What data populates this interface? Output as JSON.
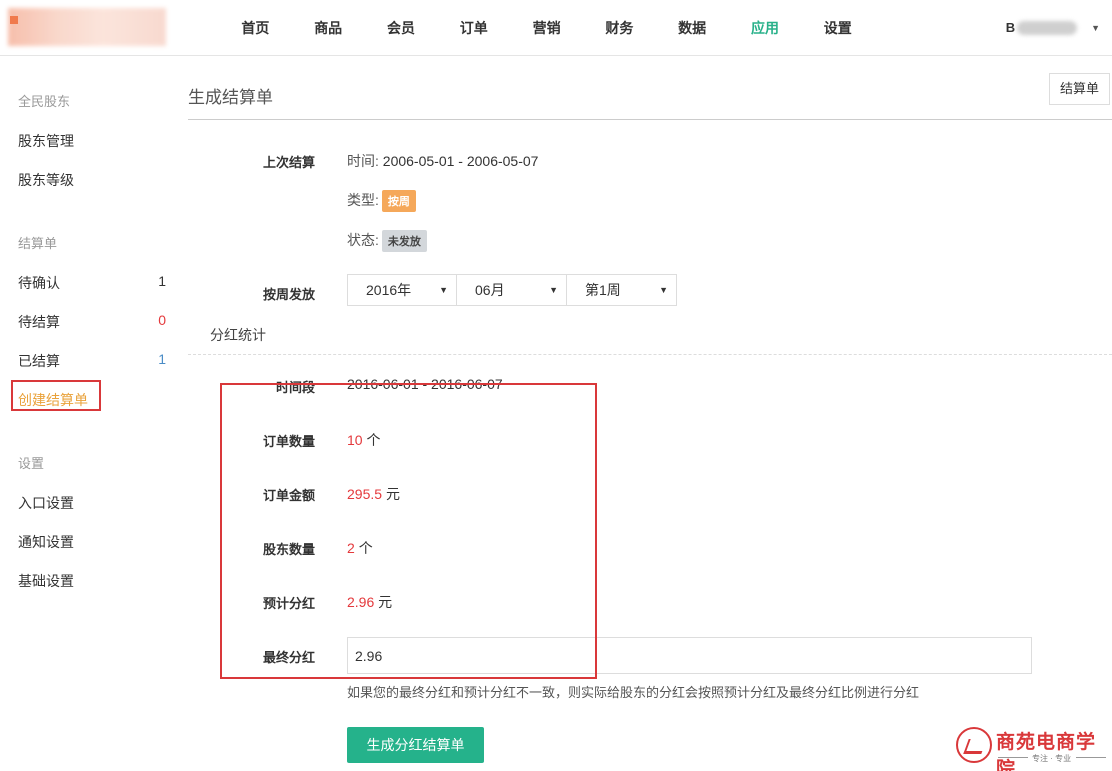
{
  "nav": {
    "items": [
      "首页",
      "商品",
      "会员",
      "订单",
      "营销",
      "财务",
      "数据",
      "应用",
      "设置"
    ],
    "active_index": 7,
    "user_initial": "B"
  },
  "sidebar": {
    "groups": [
      {
        "title": "全民股东",
        "items": [
          {
            "label": "股东管理"
          },
          {
            "label": "股东等级"
          }
        ]
      },
      {
        "title": "结算单",
        "items": [
          {
            "label": "待确认",
            "count": "1"
          },
          {
            "label": "待结算",
            "count": "0"
          },
          {
            "label": "已结算",
            "count": "1"
          },
          {
            "label": "创建结算单",
            "active": true
          }
        ]
      },
      {
        "title": "设置",
        "items": [
          {
            "label": "入口设置"
          },
          {
            "label": "通知设置"
          },
          {
            "label": "基础设置"
          }
        ]
      }
    ]
  },
  "main": {
    "title": "生成结算单",
    "top_button": "结算单",
    "last_settlement": {
      "label": "上次结算",
      "time_label": "时间:",
      "time_value": "2006-05-01 - 2006-05-07",
      "type_label": "类型:",
      "type_badge": "按周",
      "status_label": "状态:",
      "status_badge": "未发放"
    },
    "weekly_issue": {
      "label": "按周发放",
      "year": "2016年",
      "month": "06月",
      "week": "第1周"
    },
    "stats_title": "分红统计",
    "period": {
      "label": "时间段",
      "value": "2016-06-01 - 2016-06-07"
    },
    "order_count": {
      "label": "订单数量",
      "value": "10",
      "unit": "个"
    },
    "order_amount": {
      "label": "订单金额",
      "value": "295.5",
      "unit": "元"
    },
    "shareholder_count": {
      "label": "股东数量",
      "value": "2",
      "unit": "个"
    },
    "estimated_dividend": {
      "label": "预计分红",
      "value": "2.96",
      "unit": "元"
    },
    "final_dividend": {
      "label": "最终分红",
      "value": "2.96"
    },
    "hint": "如果您的最终分红和预计分红不一致，则实际给股东的分红会按照预计分红及最终分红比例进行分红",
    "submit": "生成分红结算单"
  },
  "watermark": {
    "text": "商苑电商学院",
    "sub": "专注 · 专业"
  },
  "colors": {
    "accent": "#29b18a",
    "danger": "#e4393c",
    "warning": "#e9a23b",
    "badge_orange": "#f5a85a"
  }
}
